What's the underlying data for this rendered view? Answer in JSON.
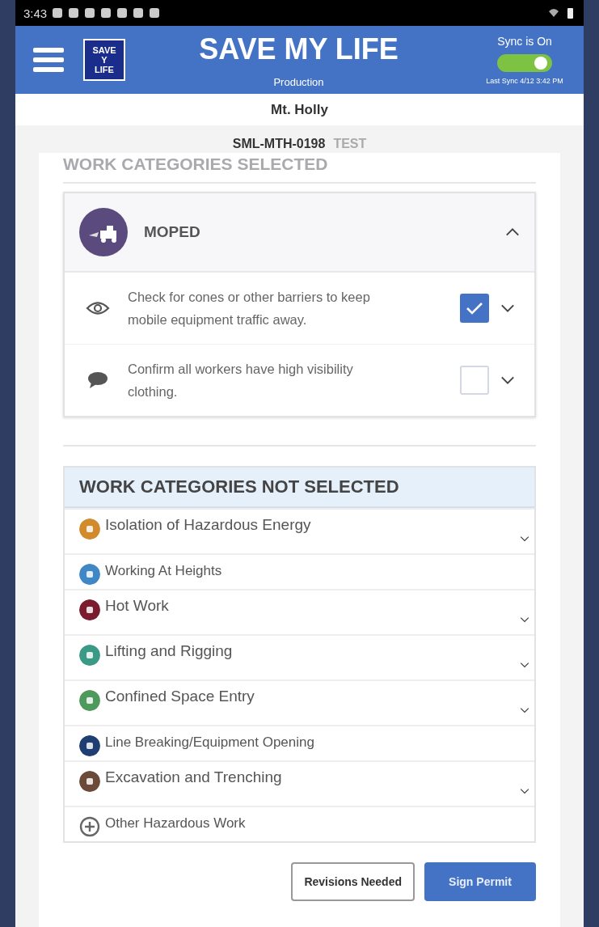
{
  "status_bar": {
    "time": "3:43"
  },
  "header": {
    "logo_lines": [
      "SAVE",
      "Y",
      "LIFE"
    ],
    "title": "SAVE MY LIFE",
    "subtitle": "Production",
    "sync_label": "Sync is On",
    "sync_on": true,
    "last_sync": "Last Sync 4/12  3:42 PM"
  },
  "site": "Mt. Holly",
  "permit": {
    "id": "SML-MTH-0198",
    "tag": "TEST"
  },
  "selected_heading": "WORK CATEGORIES SELECTED",
  "selected_category": {
    "name": "MOPED",
    "expanded": true,
    "items": [
      {
        "kind": "observe",
        "text": "Check for cones or other barriers to keep mobile equipment traffic away.",
        "checked": true
      },
      {
        "kind": "discuss",
        "text": "Confirm all workers have high visibility clothing.",
        "checked": false
      }
    ]
  },
  "not_selected": {
    "heading": "WORK CATEGORIES NOT SELECTED",
    "items": [
      {
        "name": "Isolation of Hazardous Energy",
        "color": "#d18a2c",
        "expandable": true,
        "kind": "category"
      },
      {
        "name": "Working At Heights",
        "color": "#3f88c5",
        "expandable": false,
        "kind": "category"
      },
      {
        "name": "Hot Work",
        "color": "#7a1c2e",
        "expandable": true,
        "kind": "category"
      },
      {
        "name": "Lifting and Rigging",
        "color": "#3a9a86",
        "expandable": true,
        "kind": "category"
      },
      {
        "name": "Confined Space Entry",
        "color": "#4e9a5c",
        "expandable": true,
        "kind": "category"
      },
      {
        "name": "Line Breaking/Equipment Opening",
        "color": "#1f3f73",
        "expandable": false,
        "kind": "category"
      },
      {
        "name": "Excavation and Trenching",
        "color": "#6b4a3a",
        "expandable": true,
        "kind": "category"
      },
      {
        "name": "Other Hazardous Work",
        "color": "#666666",
        "expandable": false,
        "kind": "other"
      }
    ]
  },
  "buttons": [
    {
      "label": "Revisions Needed",
      "kind": "secondary"
    },
    {
      "label": "Sign Permit",
      "kind": "primary"
    }
  ]
}
